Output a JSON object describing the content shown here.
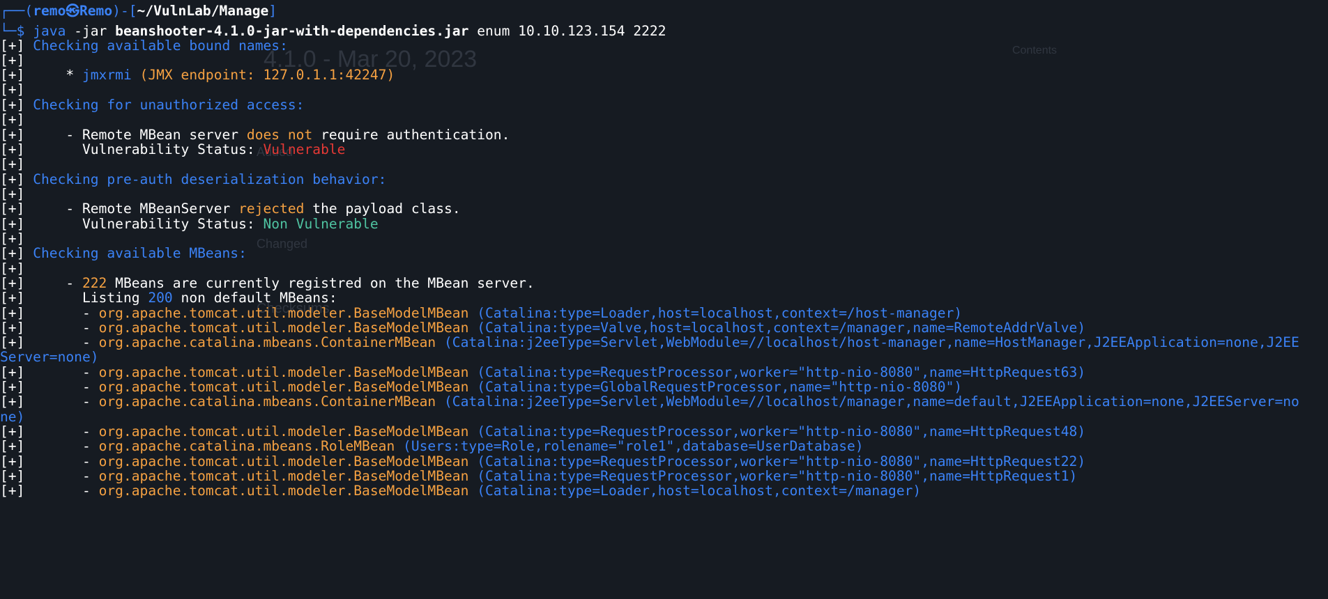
{
  "ghost": {
    "title": "4.1.0 - Mar 20, 2023",
    "side": "Contents",
    "added": "Added",
    "changed": "Changed",
    "checksums": "Checksums"
  },
  "prompt": {
    "frame_top_left": "┌──(",
    "user": "remo",
    "skull": "㉿",
    "host": "Remo",
    "frame_mid": ")-[",
    "path": "~/VulnLab/Manage",
    "frame_close": "]",
    "frame_bottom": "└─$ ",
    "cmd": "java",
    "args_pre": " -jar ",
    "jar": "beanshooter-4.1.0-jar-with-dependencies.jar",
    "args_post": " enum 10.10.123.154 2222"
  },
  "pfx": "[+] ",
  "lines": {
    "l1": "Checking available bound names:",
    "l3_bullet": "    * ",
    "l3_name": "jmxrmi",
    "l3_open": " (JMX endpoint: ",
    "l3_addr": "127.0.1.1:42247",
    "l3_close": ")",
    "l5": "Checking for unauthorized access:",
    "l7_a": "    - Remote MBean server ",
    "l7_b": "does not",
    "l7_c": " require authentication.",
    "l8_a": "      Vulnerability Status: ",
    "l8_b": "Vulnerable",
    "l10": "Checking pre-auth deserialization behavior:",
    "l12_a": "    - Remote MBeanServer ",
    "l12_b": "rejected",
    "l12_c": " the payload class.",
    "l13_a": "      Vulnerability Status: ",
    "l13_b": "Non Vulnerable",
    "l15": "Checking available MBeans:",
    "l17_a": "    - ",
    "l17_b": "222",
    "l17_c": " MBeans are currently registred on the MBean server.",
    "l18_a": "      Listing ",
    "l18_b": "200",
    "l18_c": " non default MBeans:",
    "dash": "      - "
  },
  "mbeans": [
    {
      "cls": "org.apache.tomcat.util.modeler.BaseModelMBean",
      "name": " (Catalina:type=Loader,host=localhost,context=/host-manager)"
    },
    {
      "cls": "org.apache.tomcat.util.modeler.BaseModelMBean",
      "name": " (Catalina:type=Valve,host=localhost,context=/manager,name=RemoteAddrValve)"
    },
    {
      "cls": "org.apache.catalina.mbeans.ContainerMBean",
      "name": " (Catalina:j2eeType=Servlet,WebModule=//localhost/host-manager,name=HostManager,J2EEApplication=none,J2EE",
      "cont": "Server=none)"
    },
    {
      "cls": "org.apache.tomcat.util.modeler.BaseModelMBean",
      "name": " (Catalina:type=RequestProcessor,worker=\"http-nio-8080\",name=HttpRequest63)"
    },
    {
      "cls": "org.apache.tomcat.util.modeler.BaseModelMBean",
      "name": " (Catalina:type=GlobalRequestProcessor,name=\"http-nio-8080\")"
    },
    {
      "cls": "org.apache.catalina.mbeans.ContainerMBean",
      "name": " (Catalina:j2eeType=Servlet,WebModule=//localhost/manager,name=default,J2EEApplication=none,J2EEServer=no",
      "cont": "ne)"
    },
    {
      "cls": "org.apache.tomcat.util.modeler.BaseModelMBean",
      "name": " (Catalina:type=RequestProcessor,worker=\"http-nio-8080\",name=HttpRequest48)"
    },
    {
      "cls": "org.apache.catalina.mbeans.RoleMBean",
      "name": " (Users:type=Role,rolename=\"role1\",database=UserDatabase)"
    },
    {
      "cls": "org.apache.tomcat.util.modeler.BaseModelMBean",
      "name": " (Catalina:type=RequestProcessor,worker=\"http-nio-8080\",name=HttpRequest22)"
    },
    {
      "cls": "org.apache.tomcat.util.modeler.BaseModelMBean",
      "name": " (Catalina:type=RequestProcessor,worker=\"http-nio-8080\",name=HttpRequest1)"
    },
    {
      "cls": "org.apache.tomcat.util.modeler.BaseModelMBean",
      "name": " (Catalina:type=Loader,host=localhost,context=/manager)"
    }
  ],
  "colors": {
    "background": "#161b22",
    "blue": "#3b82f6",
    "orange": "#f5a142",
    "red": "#e53935",
    "green": "#4fc3a1"
  }
}
